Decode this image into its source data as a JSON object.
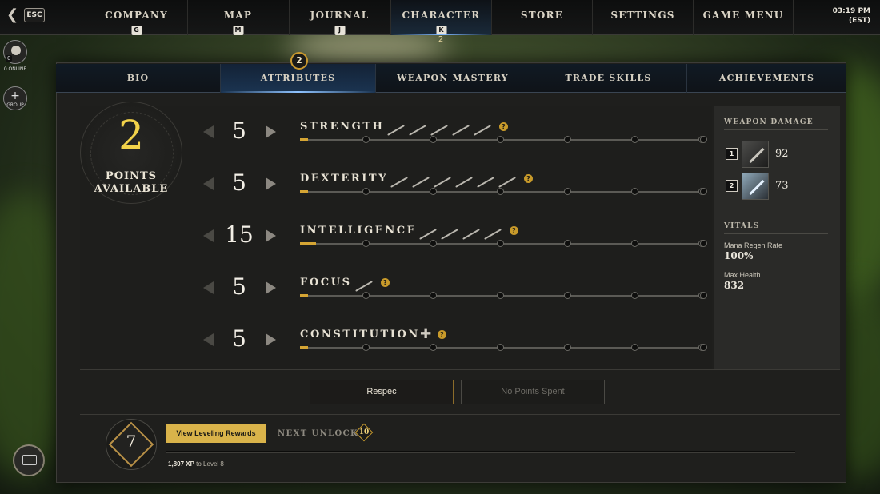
{
  "topnav": {
    "esc_label": "ESC",
    "tabs": [
      {
        "label": "COMPANY",
        "key": "G"
      },
      {
        "label": "MAP",
        "key": "M"
      },
      {
        "label": "JOURNAL",
        "key": "J"
      },
      {
        "label": "CHARACTER",
        "key": "K",
        "badge": "2"
      },
      {
        "label": "STORE",
        "key": ""
      },
      {
        "label": "SETTINGS",
        "key": ""
      },
      {
        "label": "GAME MENU",
        "key": ""
      }
    ],
    "time": "03:19 PM",
    "timezone": "(EST)"
  },
  "side": {
    "social_count": "0",
    "online_label": "0 ONLINE",
    "group_label": "GROUP",
    "group_icon": "+"
  },
  "subtabs": [
    {
      "label": "BIO"
    },
    {
      "label": "ATTRIBUTES",
      "badge": "2"
    },
    {
      "label": "WEAPON MASTERY"
    },
    {
      "label": "TRADE SKILLS"
    },
    {
      "label": "ACHIEVEMENTS"
    }
  ],
  "points": {
    "value": "2",
    "label_line1": "POINTS",
    "label_line2": "AVAILABLE"
  },
  "attributes": [
    {
      "name": "STRENGTH",
      "value": "5",
      "progress": 0.02,
      "icon_count": 5
    },
    {
      "name": "DEXTERITY",
      "value": "5",
      "progress": 0.02,
      "icon_count": 6
    },
    {
      "name": "INTELLIGENCE",
      "value": "15",
      "progress": 0.04,
      "icon_count": 4
    },
    {
      "name": "FOCUS",
      "value": "5",
      "progress": 0.02,
      "icon_count": 1
    },
    {
      "name": "CONSTITUTION",
      "value": "5",
      "progress": 0.02,
      "icon_count": 0
    }
  ],
  "help_icon": "?",
  "weapon_damage": {
    "title": "WEAPON DAMAGE",
    "slots": [
      {
        "key": "1",
        "value": "92"
      },
      {
        "key": "2",
        "value": "73"
      }
    ]
  },
  "vitals": {
    "title": "VITALS",
    "items": [
      {
        "label": "Mana Regen Rate",
        "value": "100%"
      },
      {
        "label": "Max Health",
        "value": "832"
      }
    ]
  },
  "buttons": {
    "respec": "Respec",
    "no_points": "No Points Spent"
  },
  "leveling": {
    "level": "7",
    "rewards_button": "View Leveling Rewards",
    "next_unlock_label": "NEXT UNLOCK",
    "next_unlock_level": "10",
    "xp_amount": "1,807 XP",
    "xp_suffix": "to Level 8",
    "xp_progress": 0.0
  },
  "colors": {
    "accent_gold": "#d9b34a",
    "points_yellow": "#f2d24a",
    "active_blue": "#7fb7ff"
  }
}
